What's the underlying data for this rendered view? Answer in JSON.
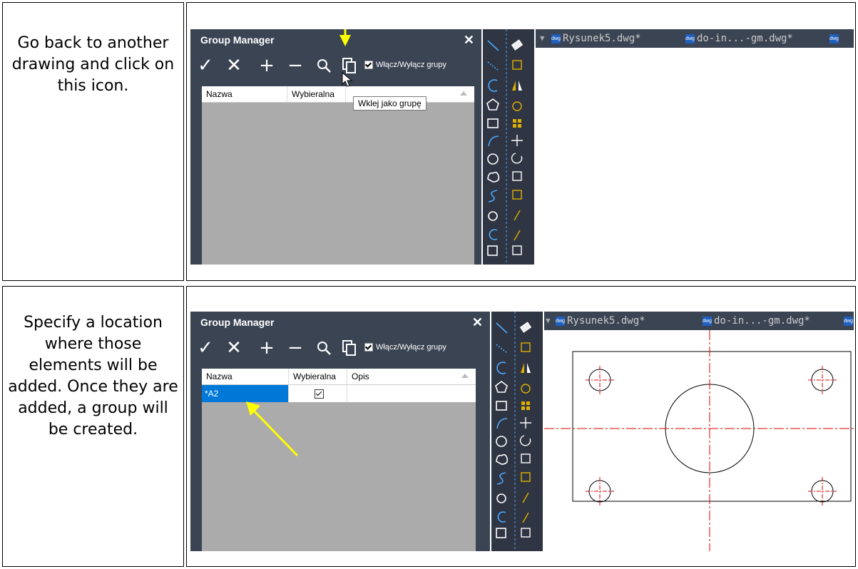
{
  "steps": [
    {
      "description": "Go back to another drawing and click on this icon."
    },
    {
      "description": "Specify a location where those elements will be added. Once they are added, a group will be created."
    }
  ],
  "group_manager": {
    "title": "Group Manager",
    "close_glyph": "✕",
    "toolbar": {
      "check_icon": "✓",
      "cross_icon": "✕",
      "plus_icon": "+",
      "minus_icon": "−",
      "toggle_label": "Włącz/Wyłącz grupy"
    },
    "columns": [
      "Nazwa",
      "Wybieralna",
      "Opis"
    ],
    "tooltip": "Wklej jako grupę",
    "rows": [
      {
        "name": "*A2",
        "selectable": true,
        "description": ""
      }
    ]
  },
  "tabs": [
    {
      "label": "Rysunek5.dwg*"
    },
    {
      "label": "do-in...-gm.dwg*"
    }
  ],
  "colors": {
    "arrow": "#ffff00",
    "selection": "#0078d7",
    "centerline": "#e00000",
    "panel": "#3b4453"
  }
}
